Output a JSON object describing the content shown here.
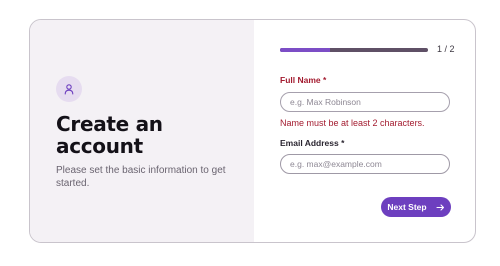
{
  "left_panel": {
    "avatar_icon": "user-icon",
    "title": "Create an account",
    "subtitle": "Please set the basic information to get started."
  },
  "progress": {
    "text": "1 / 2",
    "fraction": 0.34
  },
  "form": {
    "full_name": {
      "label": "Full Name *",
      "placeholder": "e.g. Max Robinson",
      "value": "",
      "error": "Name must be at least 2 characters."
    },
    "email": {
      "label": "Email Address *",
      "placeholder": "e.g. max@example.com",
      "value": ""
    }
  },
  "next_button": {
    "label": "Next Step",
    "icon": "arrow-right-icon"
  },
  "colors": {
    "accent": "#6d3fbf",
    "error": "#a31b2f",
    "panel_bg": "#f4f1f5"
  }
}
